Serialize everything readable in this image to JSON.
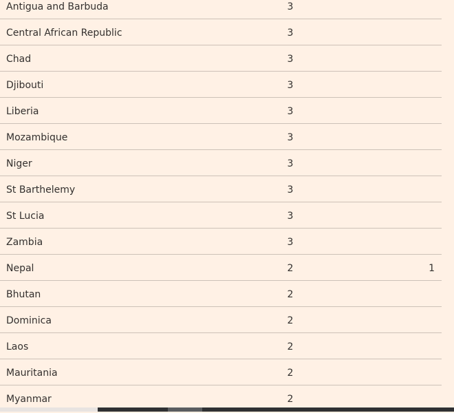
{
  "table": {
    "rows": [
      {
        "country": "Antigua and Barbuda",
        "col_a": "3",
        "col_b": ""
      },
      {
        "country": "Central African Republic",
        "col_a": "3",
        "col_b": ""
      },
      {
        "country": "Chad",
        "col_a": "3",
        "col_b": ""
      },
      {
        "country": "Djibouti",
        "col_a": "3",
        "col_b": ""
      },
      {
        "country": "Liberia",
        "col_a": "3",
        "col_b": ""
      },
      {
        "country": "Mozambique",
        "col_a": "3",
        "col_b": ""
      },
      {
        "country": "Niger",
        "col_a": "3",
        "col_b": ""
      },
      {
        "country": "St Barthelemy",
        "col_a": "3",
        "col_b": ""
      },
      {
        "country": "St Lucia",
        "col_a": "3",
        "col_b": ""
      },
      {
        "country": "Zambia",
        "col_a": "3",
        "col_b": ""
      },
      {
        "country": "Nepal",
        "col_a": "2",
        "col_b": "1"
      },
      {
        "country": "Bhutan",
        "col_a": "2",
        "col_b": ""
      },
      {
        "country": "Dominica",
        "col_a": "2",
        "col_b": ""
      },
      {
        "country": "Laos",
        "col_a": "2",
        "col_b": ""
      },
      {
        "country": "Mauritania",
        "col_a": "2",
        "col_b": ""
      },
      {
        "country": "Myanmar",
        "col_a": "2",
        "col_b": ""
      }
    ]
  },
  "colors": {
    "background": "#fff1e5",
    "row_divider": "#ccc1b7",
    "text": "#33302e",
    "scrollbar_track": "#2f3133",
    "scrollbar_thumb": "#5a5d60"
  }
}
